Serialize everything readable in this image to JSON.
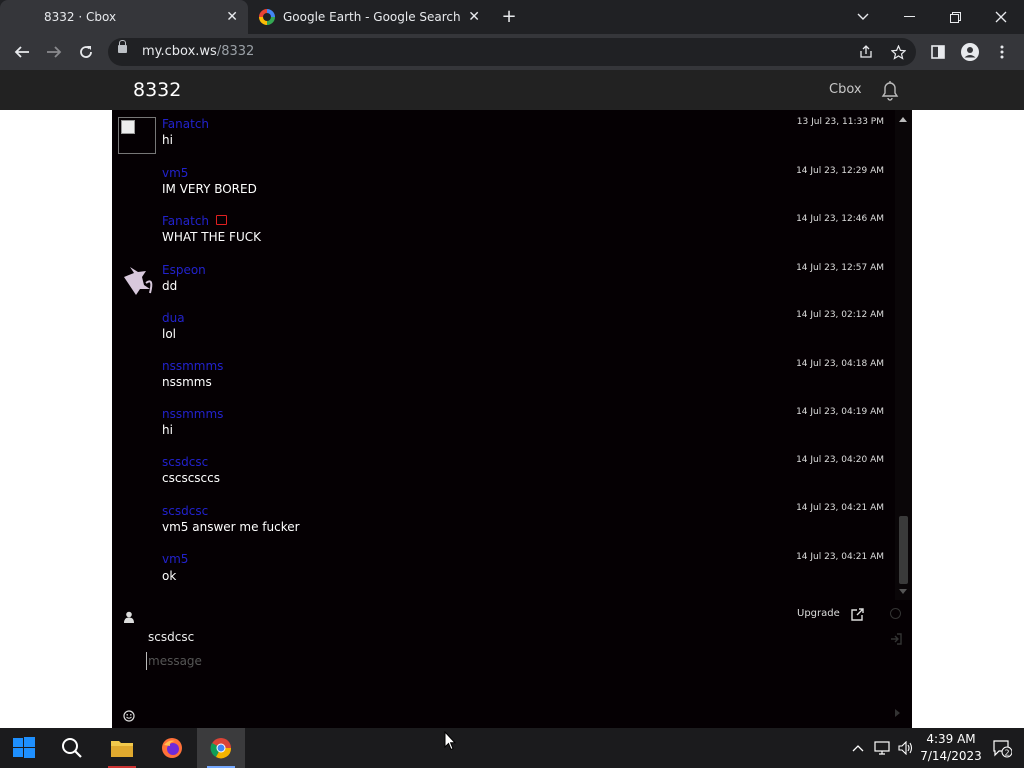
{
  "browser": {
    "tabs": [
      {
        "title": "8332 · Cbox",
        "active": true
      },
      {
        "title": "Google Earth - Google Search",
        "active": false
      }
    ],
    "url_host": "my.cbox.ws",
    "url_path": "/8332"
  },
  "page": {
    "room_title": "8332",
    "cbox_link": "Cbox"
  },
  "messages": [
    {
      "user": "Fanatch",
      "text": "hi",
      "time": "13 Jul 23, 11:33 PM"
    },
    {
      "user": "vm5",
      "text": "IM VERY BORED",
      "time": "14 Jul 23, 12:29 AM"
    },
    {
      "user": "Fanatch",
      "text": "WHAT THE FUCK",
      "time": "14 Jul 23, 12:46 AM"
    },
    {
      "user": "Espeon",
      "text": "dd",
      "time": "14 Jul 23, 12:57 AM"
    },
    {
      "user": "dua",
      "text": "lol",
      "time": "14 Jul 23, 02:12 AM"
    },
    {
      "user": "nssmmms",
      "text": "nssmms",
      "time": "14 Jul 23, 04:18 AM"
    },
    {
      "user": "nssmmms",
      "text": "hi",
      "time": "14 Jul 23, 04:19 AM"
    },
    {
      "user": "scsdcsc",
      "text": "cscscsccs",
      "time": "14 Jul 23, 04:20 AM"
    },
    {
      "user": "scsdcsc",
      "text": "vm5 answer me fucker",
      "time": "14 Jul 23, 04:21 AM"
    },
    {
      "user": "vm5",
      "text": "ok",
      "time": "14 Jul 23, 04:21 AM"
    }
  ],
  "form": {
    "upgrade_label": "Upgrade",
    "nickname": "scsdcsc",
    "message_placeholder": "message",
    "message_value": ""
  },
  "taskbar": {
    "time": "4:39 AM",
    "date": "7/14/2023",
    "notification_count": "2"
  },
  "colors": {
    "username": "#2222cc",
    "chat_background": "#050003",
    "header_background": "#222222",
    "mod_badge": "#e02020"
  }
}
